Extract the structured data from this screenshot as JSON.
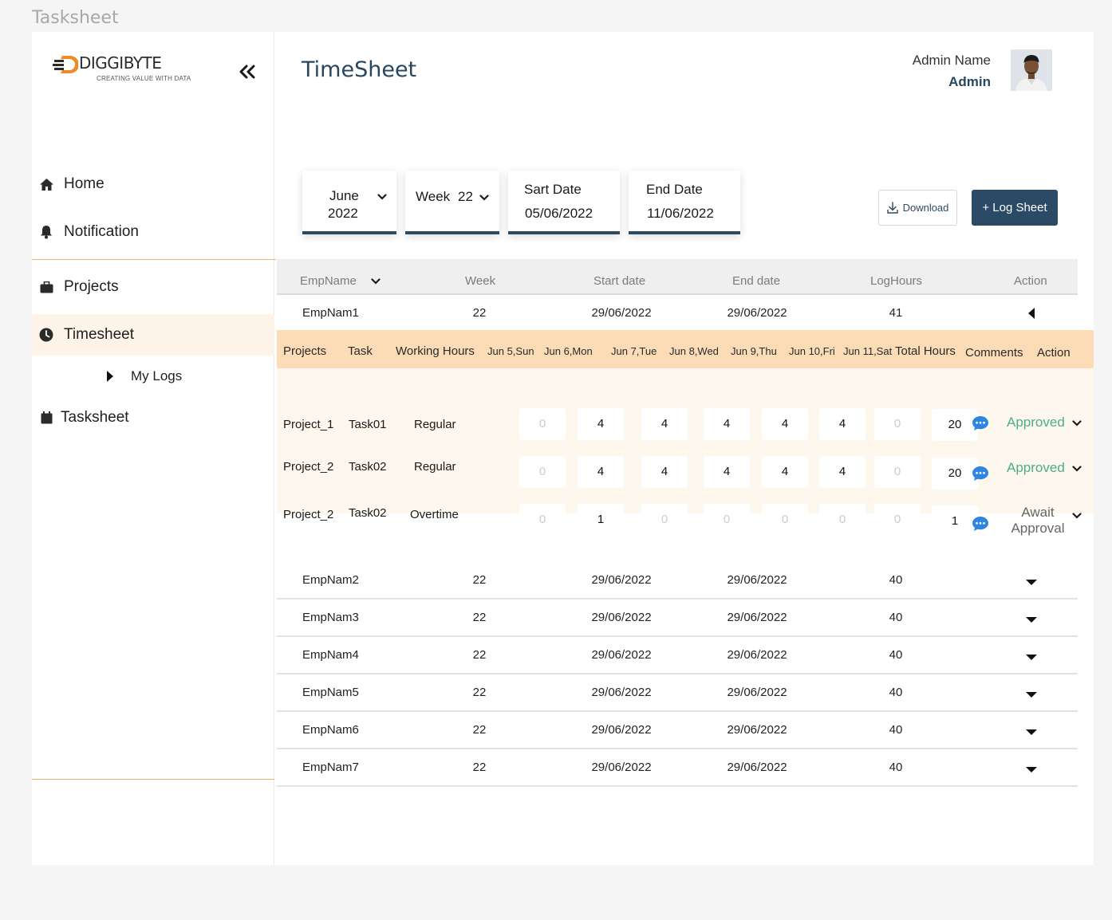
{
  "frame_label": "Tasksheet",
  "brand": {
    "name": "DIGGIBYTE",
    "tagline": "CREATING VALUE WITH DATA",
    "accent": "#f08a24",
    "primary": "#2b4a66"
  },
  "sidebar": {
    "collapse_icon": "double-chevron-left-icon",
    "items": [
      {
        "label": "Home",
        "icon": "home-icon"
      },
      {
        "label": "Notification",
        "icon": "bell-icon"
      },
      {
        "label": "Projects",
        "icon": "briefcase-icon"
      },
      {
        "label": "Timesheet",
        "icon": "clock-icon",
        "active": true
      },
      {
        "label": "My Logs",
        "icon": "caret-right-icon"
      },
      {
        "label": "Tasksheet",
        "icon": "calendar-icon"
      }
    ]
  },
  "header": {
    "title": "TimeSheet",
    "admin_name": "Admin Name",
    "admin_role": "Admin"
  },
  "filters": {
    "month": "June",
    "year": "2022",
    "week_label": "Week",
    "week_value": "22",
    "start_label": "Sart Date",
    "start_value": "05/06/2022",
    "end_label": "End Date",
    "end_value": "11/06/2022"
  },
  "actions": {
    "download": "Download",
    "log_sheet": "+ Log Sheet"
  },
  "table": {
    "columns": [
      "EmpName",
      "Week",
      "Start date",
      "End date",
      "LogHours",
      "Action"
    ],
    "rows": [
      {
        "name": "EmpNam1",
        "week": "22",
        "start": "29/06/2022",
        "end": "29/06/2022",
        "hours": "41",
        "expanded": true
      },
      {
        "name": "EmpNam2",
        "week": "22",
        "start": "29/06/2022",
        "end": "29/06/2022",
        "hours": "40"
      },
      {
        "name": "EmpNam3",
        "week": "22",
        "start": "29/06/2022",
        "end": "29/06/2022",
        "hours": "40"
      },
      {
        "name": "EmpNam4",
        "week": "22",
        "start": "29/06/2022",
        "end": "29/06/2022",
        "hours": "40"
      },
      {
        "name": "EmpNam5",
        "week": "22",
        "start": "29/06/2022",
        "end": "29/06/2022",
        "hours": "40"
      },
      {
        "name": "EmpNam6",
        "week": "22",
        "start": "29/06/2022",
        "end": "29/06/2022",
        "hours": "40"
      },
      {
        "name": "EmpNam7",
        "week": "22",
        "start": "29/06/2022",
        "end": "29/06/2022",
        "hours": "40"
      }
    ]
  },
  "detail": {
    "columns": [
      "Projects",
      "Task",
      "Working Hours",
      "Jun 5,Sun",
      "Jun 6,Mon",
      "Jun 7,Tue",
      "Jun 8,Wed",
      "Jun 9,Thu",
      "Jun 10,Fri",
      "Jun 11,Sat",
      "Total Hours",
      "Comments",
      "Action"
    ],
    "rows": [
      {
        "project": "Project_1",
        "task": "Task01",
        "type": "Regular",
        "days": [
          "0",
          "4",
          "4",
          "4",
          "4",
          "4",
          "0"
        ],
        "total": "20",
        "status": "Approved",
        "status_kind": "approved"
      },
      {
        "project": "Project_2",
        "task": "Task02",
        "type": "Regular",
        "days": [
          "0",
          "4",
          "4",
          "4",
          "4",
          "4",
          "0"
        ],
        "total": "20",
        "status": "Approved",
        "status_kind": "approved"
      },
      {
        "project": "Project_2",
        "task": "Task02",
        "type": "Overtime",
        "days": [
          "0",
          "1",
          "0",
          "0",
          "0",
          "0",
          "0"
        ],
        "total": "1",
        "status_line1": "Await",
        "status_line2": "Approval",
        "status_kind": "await"
      }
    ],
    "status_colors": {
      "approved": "#4caf86",
      "await": "#666666"
    }
  }
}
